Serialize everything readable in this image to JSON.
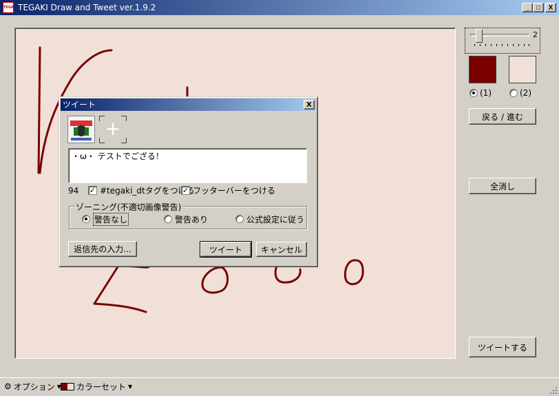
{
  "window": {
    "title": "TEGAKI Draw and Tweet ver.1.9.2",
    "icon_text": "TEGAKI",
    "minimize": "_",
    "maximize": "□",
    "close": "X"
  },
  "brush": {
    "size_value": "2",
    "size_level": 0.1,
    "color1": "#7a0000",
    "color2": "#f0e0d8",
    "radio1_label": "(1)",
    "radio2_label": "(2)",
    "selected": 1
  },
  "right_panel": {
    "undo_redo_label": "戻る / 進む",
    "clear_all_label": "全消し",
    "tweet_label": "ツイートする"
  },
  "statusbar": {
    "options_label": "オプション",
    "colorset_label": "カラーセット"
  },
  "dialog": {
    "title": "ツイート",
    "close": "X",
    "add_symbol": "+",
    "tweet_text": "・ω・ テストでござる！",
    "char_count": "94",
    "hashtag_label": "#tegaki_dtタグをつける",
    "hashtag_checked": true,
    "footer_label": "フッターバーをつける",
    "footer_checked": true,
    "zoning_legend": "ゾーニング(不適切画像警告)",
    "zoning_options": [
      "警告なし",
      "警告あり",
      "公式設定に従う"
    ],
    "zoning_selected": 0,
    "reply_label": "返信先の入力...",
    "tweet_button": "ツイート",
    "cancel_button": "キャンセル"
  },
  "colors": {
    "stroke": "#7a0000",
    "canvas_bg": "#f0e0d8"
  }
}
